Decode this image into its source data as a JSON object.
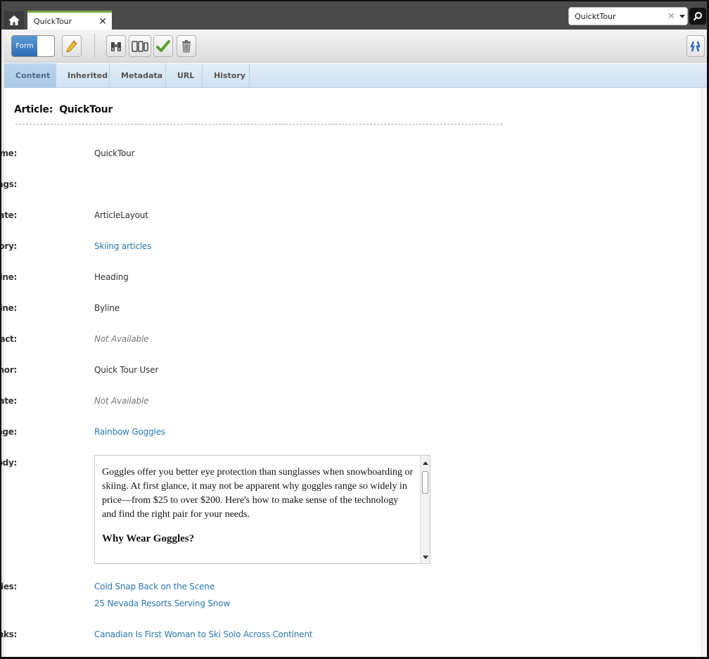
{
  "header": {
    "tab_label": "QuickTour",
    "search_value": "QuicktTour"
  },
  "toolbar": {
    "form_toggle_label": "Form"
  },
  "subtabs": [
    "Content",
    "Inherited",
    "Metadata",
    "URL",
    "History"
  ],
  "article": {
    "title_prefix": "Article:",
    "title_name": "QuickTour"
  },
  "fields": {
    "name": {
      "label": "Name:",
      "value": "QuickTour",
      "required_mark": "*"
    },
    "tags": {
      "label": "Tags:",
      "value": ""
    },
    "template": {
      "label": "Template:",
      "value": "ArticleLayout"
    },
    "category": {
      "label": "Category:",
      "value": "Skiing articles"
    },
    "headline": {
      "label": "Headline:",
      "value": "Heading"
    },
    "subheadline": {
      "label": "Sub-headline:",
      "value": "Byline"
    },
    "abstract": {
      "label": "Abstract:",
      "value": "Not Available"
    },
    "author": {
      "label": "Author:",
      "value": "Quick Tour User"
    },
    "post_date": {
      "label": "Post Date:",
      "value": "Not Available"
    },
    "main_image": {
      "label": "Main Image:",
      "value": "Rainbow Goggles"
    },
    "body": {
      "label": "Body:",
      "paragraph": "Goggles offer you better eye protection than sunglasses when snowboarding or skiing. At first glance, it may not be apparent why goggles range so widely in price—from $25 to over $200. Here's how to make sense of the technology and find the right pair for your needs.",
      "heading": "Why Wear Goggles?"
    },
    "related_stories": {
      "label": "Related Stories:",
      "items": [
        "Cold Snap Back on the Scene",
        "25 Nevada Resorts Serving Snow"
      ]
    },
    "related_links": {
      "label": "Related Links:",
      "items": [
        "Canadian Is First Woman to Ski Solo Across Continent"
      ]
    }
  },
  "colors": {
    "accent_blue": "#2a78b4",
    "tab_accent_green": "#78a640",
    "required_red": "#cc2222"
  }
}
